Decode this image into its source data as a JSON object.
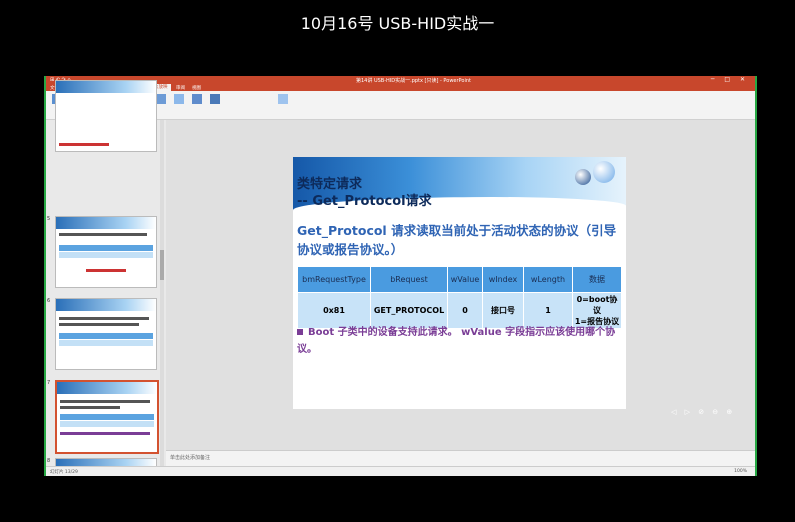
{
  "video_title": "10月16号 USB-HID实战一",
  "app": {
    "quick_access": "⊞ ↶ ↷ ⌂",
    "document_title": "第14讲 USB-HID实战一.pptx [只读] - PowerPoint",
    "window_controls": "─ □ ✕",
    "tabs": [
      "文件",
      "开始",
      "插入",
      "设计",
      "切换",
      "动画",
      "幻灯片放映",
      "审阅",
      "视图"
    ],
    "active_tab": "幻灯片放映",
    "notes_placeholder": "单击此处添加备注",
    "status_left": "幻灯片 13/29",
    "zoom": "100%"
  },
  "thumbnails": [
    {
      "num": "",
      "title": "类特定请求"
    },
    {
      "num": "5",
      "title": "类特定请求 -- Get_Report"
    },
    {
      "num": "6",
      "title": "类特定请求 -- Set_Report"
    },
    {
      "num": "7",
      "title": "类特定请求 -- Get_Protocol"
    },
    {
      "num": "8",
      "title": "类特定请求 -- Set_Protocol"
    }
  ],
  "slide": {
    "title_line1": "类特定请求",
    "title_line2": "-- Get_Protocol请求",
    "body": "Get_Protocol 请求读取当前处于活动状态的协议（引导协议或报告协议。）",
    "table": {
      "headers": [
        "bmRequestType",
        "bRequest",
        "wValue",
        "wIndex",
        "wLength",
        "数据"
      ],
      "row": [
        "0x81",
        "GET_PROTOCOL",
        "0",
        "接口号",
        "1",
        "0=boot协议\n1=报告协议"
      ]
    },
    "bullet": "Boot 子类中的设备支持此请求。 wValue 字段指示应该使用哪个协议。"
  },
  "player_controls": "◁ ▷ ⊘ ⊖ ⊕"
}
